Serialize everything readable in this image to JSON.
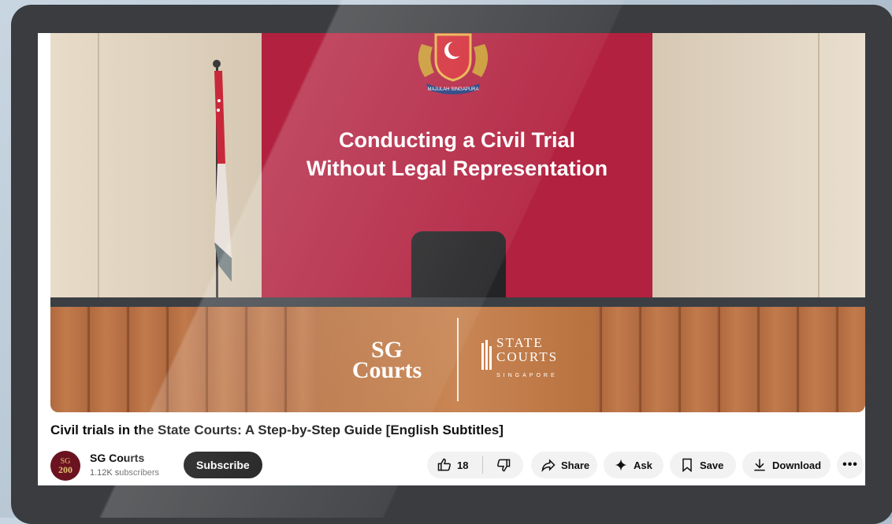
{
  "video": {
    "slide_title_line1": "Conducting a Civil Trial",
    "slide_title_line2": "Without Legal Representation",
    "crest_motto": "MAJULAH SINGAPURA",
    "logo_sg": "SG",
    "logo_courts": "Courts",
    "logo_state_line1": "STATE",
    "logo_state_line2": "COURTS",
    "logo_state_line3": "SINGAPORE"
  },
  "title": "Civil trials in the State Courts: A Step-by-Step Guide [English Subtitles]",
  "channel": {
    "name": "SG Courts",
    "subscribers": "1.12K subscribers",
    "avatar_text_top": "SG",
    "avatar_text_num": "200"
  },
  "actions": {
    "subscribe": "Subscribe",
    "likes": "18",
    "share": "Share",
    "ask": "Ask",
    "save": "Save",
    "download": "Download",
    "more": "•••"
  },
  "colors": {
    "backdrop_red": "#b2213f",
    "subscribe_bg": "#0f0f0f",
    "pill_bg": "#f2f2f2",
    "avatar_bg": "#6b1320"
  }
}
